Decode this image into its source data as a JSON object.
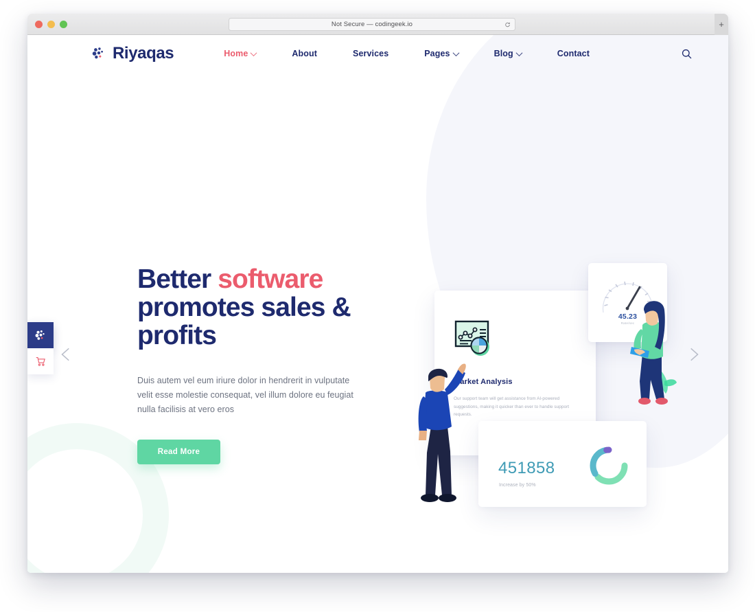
{
  "browser": {
    "url_text": "Not Secure — codingeek.io",
    "reload_icon": "reload-icon",
    "new_tab_icon": "plus-icon",
    "traffic_lights": [
      "close-red",
      "minimize-yellow",
      "maximize-green"
    ]
  },
  "nav": {
    "brand": "Riyaqas",
    "brand_mark_icon": "riyaqas-logo-mark",
    "search_icon": "search-icon",
    "links": [
      {
        "label": "Home",
        "has_dropdown": true,
        "active": true
      },
      {
        "label": "About",
        "has_dropdown": false,
        "active": false
      },
      {
        "label": "Services",
        "has_dropdown": false,
        "active": false
      },
      {
        "label": "Pages",
        "has_dropdown": true,
        "active": false
      },
      {
        "label": "Blog",
        "has_dropdown": true,
        "active": false
      },
      {
        "label": "Contact",
        "has_dropdown": false,
        "active": false
      }
    ]
  },
  "hero": {
    "title_part1": "Better ",
    "title_accent": "software",
    "title_part2": " promotes sales & profits",
    "description": "Duis autem vel eum iriure dolor in hendrerit in vulputate velit esse molestie consequat, vel illum dolore eu feugiat nulla facilisis at vero eros",
    "cta_label": "Read More"
  },
  "illustration": {
    "market_card": {
      "icon": "market-analysis-chart-icon",
      "title": "Market Analysis",
      "description": "Our support team will get assistance from AI-powered suggestions, making it quicker than ever to handle support requests."
    },
    "stat_card": {
      "value": "451858",
      "subtitle": "Increase by 50%",
      "donut_icon": "donut-chart-icon"
    },
    "gauge_card": {
      "value": "45.23",
      "label": "Rate/sec",
      "gauge_icon": "speedometer-gauge-icon"
    },
    "figures": [
      {
        "name": "man-pointing-illustration"
      },
      {
        "name": "woman-with-tablet-illustration"
      }
    ]
  },
  "side_widgets": [
    {
      "icon": "riyaqas-logo-mark",
      "name": "logo-tile"
    },
    {
      "icon": "shopping-cart-icon",
      "name": "cart-tile"
    }
  ],
  "carousel": {
    "prev_icon": "chevron-left-icon",
    "next_icon": "chevron-right-icon",
    "dots": [
      {
        "active": true
      },
      {
        "active": false
      },
      {
        "active": false
      }
    ]
  },
  "colors": {
    "brand_navy": "#1e2a6e",
    "accent_red": "#eb5c6d",
    "cta_green": "#5fd6a3",
    "stat_teal": "#3f9bb5",
    "dot_active": "#d6426a"
  }
}
